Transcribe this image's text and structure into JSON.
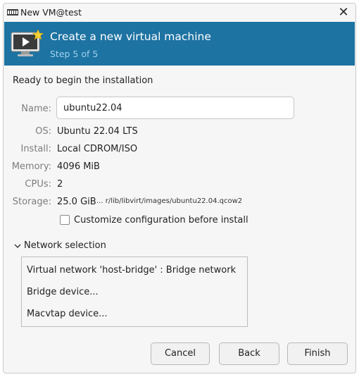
{
  "window": {
    "title": "New VM@test"
  },
  "header": {
    "title": "Create a new virtual machine",
    "step": "Step 5 of 5"
  },
  "summary": {
    "heading": "Ready to begin the installation",
    "name_label": "Name:",
    "name_value": "ubuntu22.04",
    "os_label": "OS:",
    "os_value": "Ubuntu 22.04 LTS",
    "install_label": "Install:",
    "install_value": "Local CDROM/ISO",
    "memory_label": "Memory:",
    "memory_value": "4096 MiB",
    "cpus_label": "CPUs:",
    "cpus_value": "2",
    "storage_label": "Storage:",
    "storage_value": "25.0 GiB",
    "storage_path": "... r/lib/libvirt/images/ubuntu22.04.qcow2"
  },
  "customize": {
    "label": "Customize configuration before install",
    "checked": false
  },
  "network": {
    "label": "Network selection",
    "expanded": true,
    "options": [
      "Virtual network 'host-bridge' : Bridge network",
      "Bridge device...",
      "Macvtap device..."
    ]
  },
  "buttons": {
    "cancel": "Cancel",
    "back": "Back",
    "finish": "Finish"
  },
  "colors": {
    "banner": "#1d73a2",
    "step_text": "#9fd1ef"
  },
  "icons": {
    "title": "vm-manager-icon",
    "close": "close-icon",
    "banner": "new-vm-monitor-icon",
    "expander": "chevron-down-icon"
  }
}
